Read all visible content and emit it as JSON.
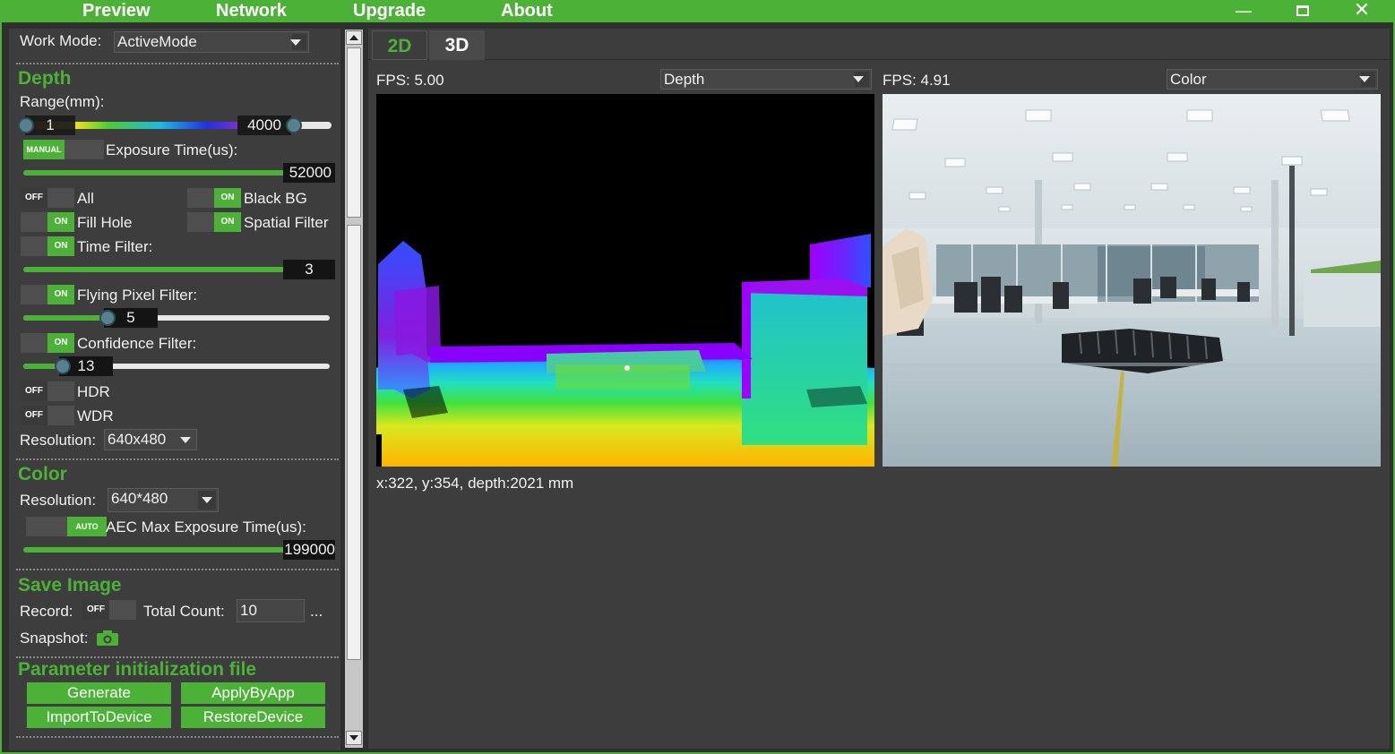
{
  "menu": {
    "items": [
      "Preview",
      "Network",
      "Upgrade",
      "About"
    ]
  },
  "window": {
    "minimize": "—",
    "maximize": "☐",
    "close": "✕"
  },
  "left": {
    "work_mode_label": "Work Mode:",
    "work_mode_value": "ActiveMode",
    "depth": {
      "title": "Depth",
      "range_label": "Range(mm):",
      "range_min": "1",
      "range_max": "4000",
      "exposure_toggle": "MANUAL",
      "exposure_label": "Exposure Time(us):",
      "exposure_value": "52000",
      "exposure_level": 0.95,
      "toggles": {
        "all": {
          "state": "OFF",
          "label": "All"
        },
        "black_bg": {
          "state": "ON",
          "label": "Black BG"
        },
        "fill_hole": {
          "state": "ON",
          "label": "Fill Hole"
        },
        "spatial": {
          "state": "ON",
          "label": "Spatial Filter"
        },
        "time": {
          "state": "ON",
          "label": "Time Filter:"
        },
        "flying": {
          "state": "ON",
          "label": "Flying Pixel Filter:"
        },
        "confidence": {
          "state": "ON",
          "label": "Confidence Filter:"
        },
        "hdr": {
          "state": "OFF",
          "label": "HDR"
        },
        "wdr": {
          "state": "OFF",
          "label": "WDR"
        }
      },
      "time_value": "3",
      "time_level": 0.95,
      "flying_value": "5",
      "flying_level": 0.25,
      "confidence_value": "13",
      "confidence_level": 0.13,
      "resolution_label": "Resolution:",
      "resolution_value": "640x480"
    },
    "color": {
      "title": "Color",
      "resolution_label": "Resolution:",
      "resolution_value": "640*480",
      "aec_toggle": "AUTO",
      "aec_label": "AEC Max Exposure Time(us):",
      "aec_value": "199000",
      "aec_level": 0.95
    },
    "save": {
      "title": "Save Image",
      "record_label": "Record:",
      "record_state": "OFF",
      "total_label": "Total Count:",
      "total_value": "10",
      "more": "...",
      "snapshot_label": "Snapshot:"
    },
    "param": {
      "title": "Parameter initialization file",
      "generate": "Generate",
      "apply": "ApplyByApp",
      "import": "ImportToDevice",
      "restore": "RestoreDevice"
    }
  },
  "tabs": [
    "2D",
    "3D"
  ],
  "left_view": {
    "fps": "FPS: 5.00",
    "mode": "Depth"
  },
  "right_view": {
    "fps": "FPS: 4.91",
    "mode": "Color"
  },
  "status": "x:322, y:354, depth:2021 mm"
}
